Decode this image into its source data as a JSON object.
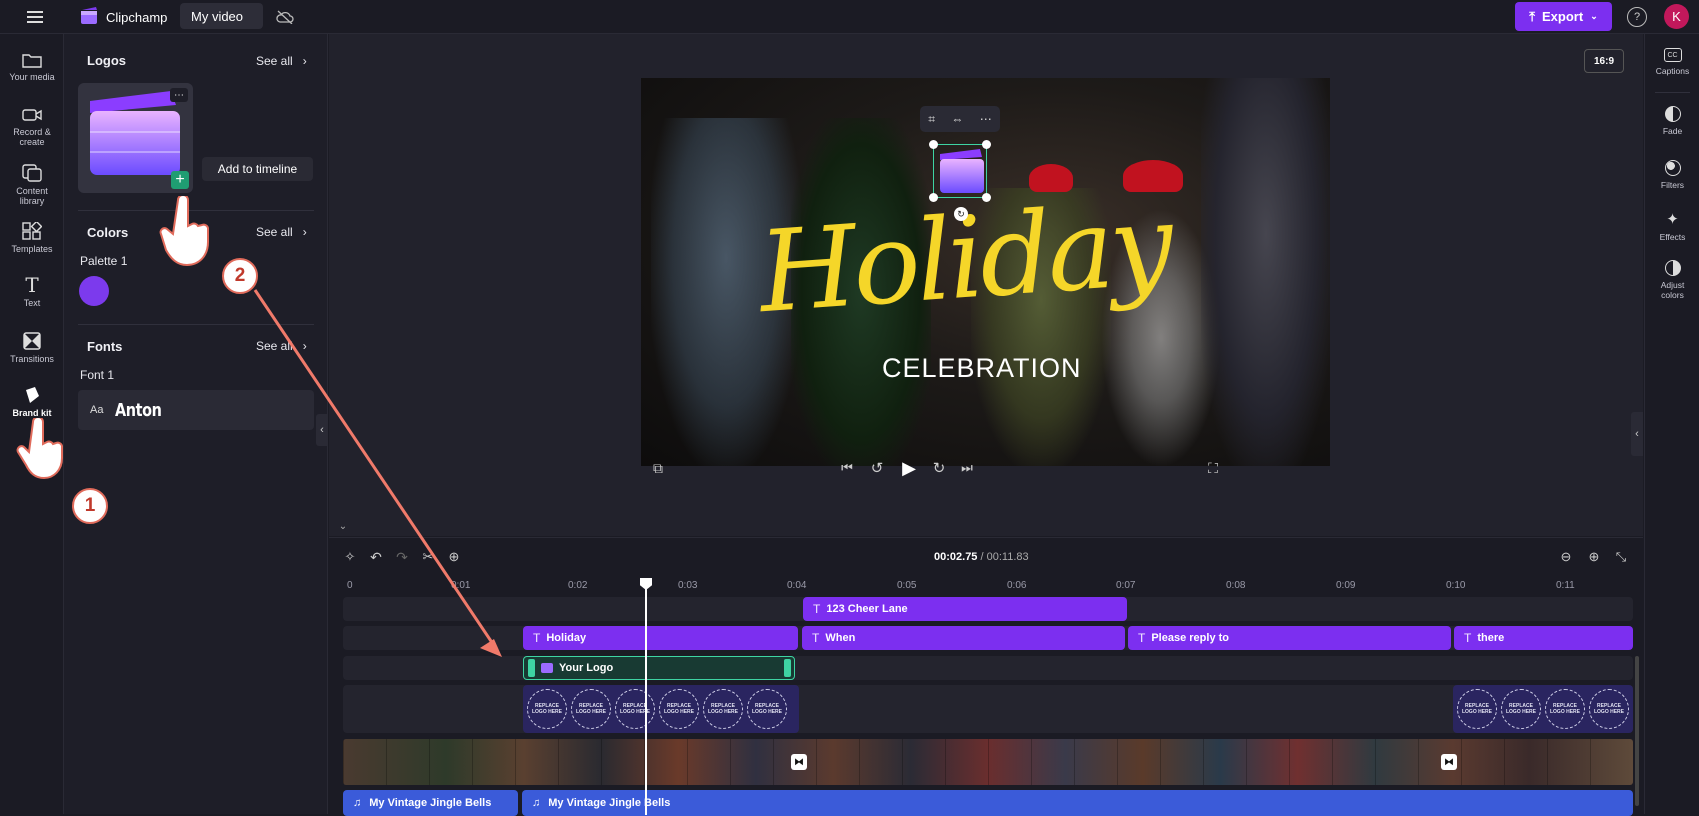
{
  "app": {
    "name": "Clipchamp",
    "project_name": "My video",
    "avatar_initial": "K",
    "export_label": "Export"
  },
  "left_rail": {
    "items": [
      {
        "label": "Your media",
        "icon": "folder-icon"
      },
      {
        "label": "Record & create",
        "icon": "camera-icon"
      },
      {
        "label": "Content library",
        "icon": "library-icon"
      },
      {
        "label": "Templates",
        "icon": "templates-icon"
      },
      {
        "label": "Text",
        "icon": "text-icon"
      },
      {
        "label": "Transitions",
        "icon": "transitions-icon"
      },
      {
        "label": "Brand kit",
        "icon": "brand-kit-icon"
      }
    ]
  },
  "panel": {
    "logos": {
      "title": "Logos",
      "see_all": "See all",
      "add_tooltip": "Add to timeline"
    },
    "colors": {
      "title": "Colors",
      "see_all": "See all",
      "palette_label": "Palette 1",
      "swatch": "#7c3aed"
    },
    "fonts": {
      "title": "Fonts",
      "see_all": "See all",
      "font_label": "Font 1",
      "font_icon": "Aa",
      "font_name": "Anton"
    }
  },
  "preview": {
    "aspect_ratio": "16:9",
    "title_line1": "Holiday",
    "title_line2": "CELEBRATION"
  },
  "playback": {
    "current_time": "00:02.75",
    "total_time": "/ 00:11.83"
  },
  "ruler": [
    "0",
    "0:01",
    "0:02",
    "0:03",
    "0:04",
    "0:05",
    "0:06",
    "0:07",
    "0:08",
    "0:09",
    "0:10",
    "0:11"
  ],
  "tracks": {
    "text_top": [
      {
        "label": "123 Cheer Lane"
      }
    ],
    "text_row": [
      {
        "label": "Holiday"
      },
      {
        "label": "When"
      },
      {
        "label": "Please reply to"
      },
      {
        "label": "there"
      }
    ],
    "logo_clip": {
      "label": "Your Logo"
    },
    "placeholder_text": "REPLACE LOGO HERE",
    "audio": [
      {
        "label": "My Vintage Jingle Bells"
      },
      {
        "label": "My Vintage Jingle Bells"
      }
    ]
  },
  "right_rail": {
    "items": [
      {
        "label": "Captions",
        "icon": "captions-icon"
      },
      {
        "label": "Fade",
        "icon": "fade-icon"
      },
      {
        "label": "Filters",
        "icon": "filters-icon"
      },
      {
        "label": "Effects",
        "icon": "effects-icon"
      },
      {
        "label": "Adjust colors",
        "icon": "adjust-colors-icon"
      }
    ]
  },
  "annotations": {
    "step1": "1",
    "step2": "2"
  },
  "colors": {
    "accent": "#7c2ff0",
    "logo_clip_border": "#3ed4a3",
    "audio": "#3b5bd9",
    "arrow": "#f07a6a"
  }
}
